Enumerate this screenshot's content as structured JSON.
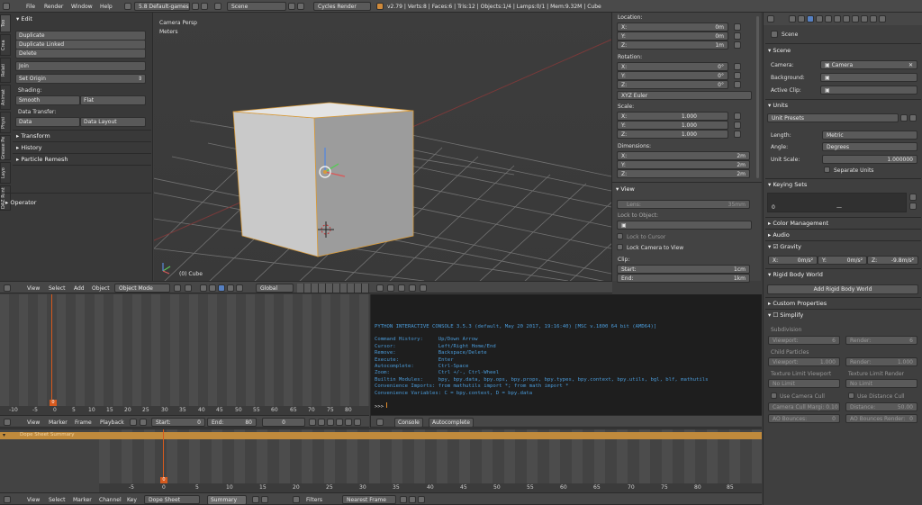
{
  "topbar": {
    "menus": [
      "File",
      "Render",
      "Window",
      "Help"
    ],
    "screen_layout": "5.8 Default-games",
    "scene": "Scene",
    "render_engine": "Cycles Render",
    "stats": "v2.79 | Verts:8 | Faces:6 | Tris:12 | Objects:1/4 | Lamps:0/1 | Mem:9.32M | Cube"
  },
  "tool_shelf": {
    "tabs": [
      "Too",
      "Crea",
      "Relati",
      "Animat",
      "Physi",
      "Grease Pe",
      "Layo",
      "DAZ Runt"
    ],
    "edit_header": "Edit",
    "buttons": [
      "Duplicate",
      "Duplicate Linked",
      "Delete",
      "Join"
    ],
    "set_origin": "Set Origin",
    "shading_label": "Shading:",
    "smooth": "Smooth",
    "flat": "Flat",
    "data_transfer_label": "Data Transfer:",
    "data": "Data",
    "data_layout": "Data Layout",
    "panels": [
      "Transform",
      "History",
      "Particle Remesh"
    ],
    "operator": "Operator"
  },
  "viewport": {
    "view_label": "Camera Persp",
    "units_label": "Meters",
    "object_label": "(0) Cube",
    "header_menus": [
      "View",
      "Select",
      "Add",
      "Object"
    ],
    "mode": "Object Mode",
    "orientation": "Global"
  },
  "n_panel": {
    "location_label": "Location:",
    "location": [
      {
        "axis": "X:",
        "value": "0m"
      },
      {
        "axis": "Y:",
        "value": "0m"
      },
      {
        "axis": "Z:",
        "value": "1m"
      }
    ],
    "rotation_label": "Rotation:",
    "rotation": [
      {
        "axis": "X:",
        "value": "0°"
      },
      {
        "axis": "Y:",
        "value": "0°"
      },
      {
        "axis": "Z:",
        "value": "0°"
      }
    ],
    "rotation_mode": "XYZ Euler",
    "scale_label": "Scale:",
    "scale": [
      {
        "axis": "X:",
        "value": "1.000"
      },
      {
        "axis": "Y:",
        "value": "1.000"
      },
      {
        "axis": "Z:",
        "value": "1.000"
      }
    ],
    "dimensions_label": "Dimensions:",
    "dimensions": [
      {
        "axis": "X:",
        "value": "2m"
      },
      {
        "axis": "Y:",
        "value": "2m"
      },
      {
        "axis": "Z:",
        "value": "2m"
      }
    ],
    "view_header": "View",
    "lens_label": "Lens:",
    "lens_value": "35mm",
    "lock_to_object": "Lock to Object:",
    "lock_to_cursor": "Lock to Cursor",
    "lock_camera": "Lock Camera to View",
    "clip_label": "Clip:",
    "clip_start_label": "Start:",
    "clip_start": "1cm",
    "clip_end_label": "End:",
    "clip_end": "1km"
  },
  "properties": {
    "scene_path": "Scene",
    "scene_header": "Scene",
    "camera_label": "Camera:",
    "camera_value": "Camera",
    "background_label": "Background:",
    "active_clip_label": "Active Clip:",
    "units_header": "Units",
    "unit_presets": "Unit Presets",
    "length_label": "Length:",
    "length_value": "Metric",
    "angle_label": "Angle:",
    "angle_value": "Degrees",
    "unit_scale_label": "Unit Scale:",
    "unit_scale_value": "1.000000",
    "separate_units": "Separate Units",
    "keying_header": "Keying Sets",
    "keying_zero": "0",
    "keying_dash": "—",
    "color_mgmt": "Color Management",
    "audio": "Audio",
    "gravity": "Gravity",
    "gravity_values": [
      {
        "axis": "X:",
        "value": "0m/s²"
      },
      {
        "axis": "Y:",
        "value": "0m/s²"
      },
      {
        "axis": "Z:",
        "value": "-9.8m/s²"
      }
    ],
    "rigid_body": "Rigid Body World",
    "add_rigid": "Add Rigid Body World",
    "custom_props": "Custom Properties",
    "simplify": "Simplify",
    "subdivision_label": "Subdivision",
    "viewport_label": "Viewport:",
    "viewport_val": "6",
    "render_label": "Render:",
    "render_val": "6",
    "child_particles": "Child Particles",
    "viewport_cp": "1.000",
    "render_cp": "1.000",
    "tex_limit_viewport": "Texture Limit Viewport",
    "tex_limit_render": "Texture Limit Render",
    "no_limit": "No Limit",
    "use_camera_cull": "Use Camera Cull",
    "use_distance_cull": "Use Distance Cull",
    "cam_cull_margin": "Camera Cull Margi: 0.10",
    "distance": "Distance:",
    "distance_val": "50.00",
    "ao_bounces": "AO Bounces:",
    "ao_bounces_val": "0",
    "ao_bounces_render": "AO Bounces Render:",
    "ao_bounces_render_val": "0"
  },
  "timeline": {
    "ticks": [
      "-10",
      "-5",
      "0",
      "5",
      "10",
      "15",
      "20",
      "25",
      "30",
      "35",
      "40",
      "45",
      "50",
      "55",
      "60",
      "65",
      "70",
      "75",
      "80"
    ],
    "current": "0",
    "menus": [
      "View",
      "Marker",
      "Frame",
      "Playback"
    ],
    "start_label": "Start:",
    "start": "0",
    "end_label": "End:",
    "end": "80",
    "frame": "0"
  },
  "console": {
    "lines": [
      "PYTHON INTERACTIVE CONSOLE 3.5.3 (default, May 20 2017, 19:16:40) [MSC v.1800 64 bit (AMD64)]",
      "",
      "Command History:     Up/Down Arrow",
      "Cursor:              Left/Right Home/End",
      "Remove:              Backspace/Delete",
      "Execute:             Enter",
      "Autocomplete:        Ctrl-Space",
      "Zoom:                Ctrl +/-, Ctrl-Wheel",
      "Builtin Modules:     bpy, bpy.data, bpy.ops, bpy.props, bpy.types, bpy.context, bpy.utils, bgl, blf, mathutils",
      "Convenience Imports: from mathutils import *; from math import *",
      "Convenience Variables: C = bpy.context, D = bpy.data"
    ],
    "prompt": ">>> ",
    "tabs": [
      "Console",
      "Autocomplete"
    ]
  },
  "dopesheet": {
    "summary": "Dope Sheet Summary",
    "ticks": [
      "-5",
      "0",
      "5",
      "10",
      "15",
      "20",
      "25",
      "30",
      "35",
      "40",
      "45",
      "50",
      "55",
      "60",
      "65",
      "70",
      "75",
      "80",
      "85"
    ],
    "current": "0",
    "menus": [
      "View",
      "Select",
      "Marker",
      "Channel",
      "Key"
    ],
    "mode": "Dope Sheet",
    "summary_btn": "Summary",
    "filters": "Filters",
    "snap": "Nearest Frame"
  }
}
